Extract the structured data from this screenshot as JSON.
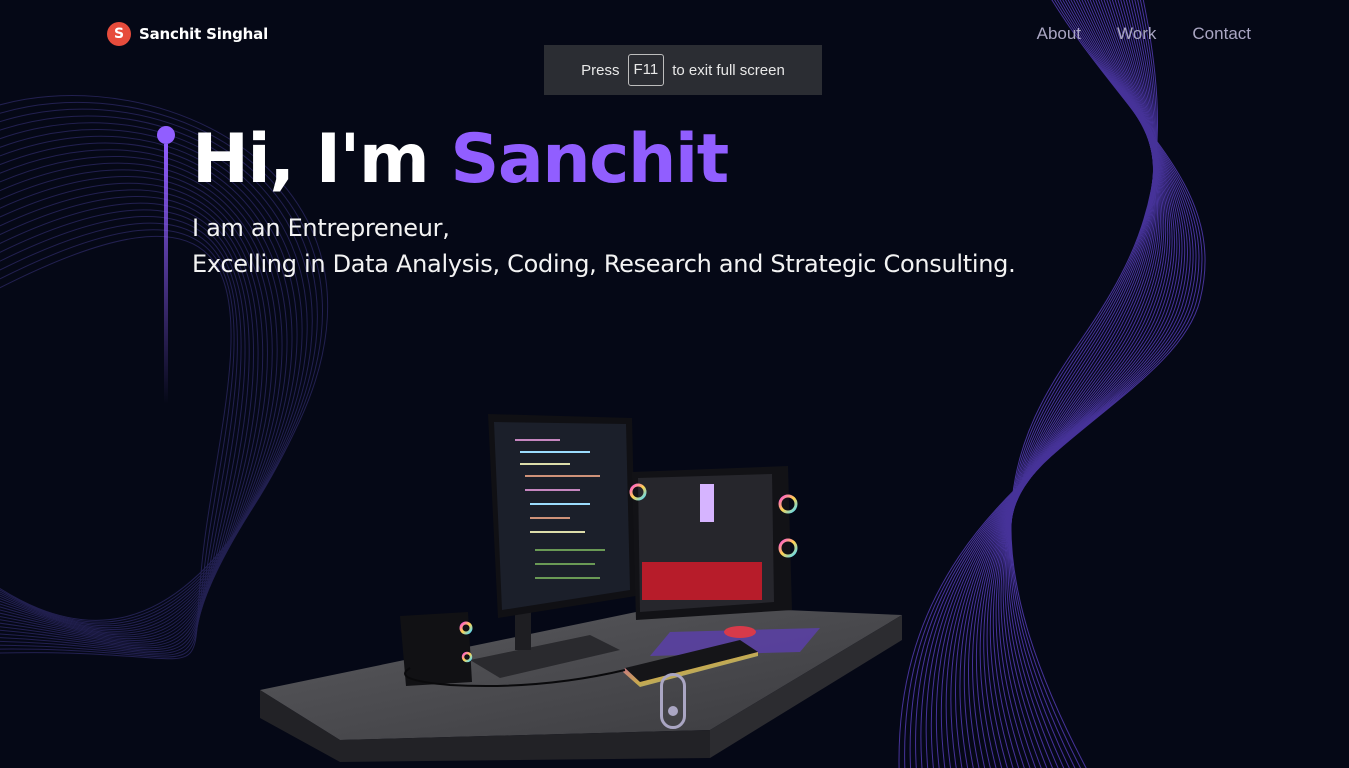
{
  "nav": {
    "logo_letter": "S",
    "brand_name": "Sanchit Singhal",
    "links": [
      {
        "label": "About"
      },
      {
        "label": "Work"
      },
      {
        "label": "Contact"
      }
    ]
  },
  "fullscreen_toast": {
    "before": "Press",
    "key": "F11",
    "after": "to exit full screen"
  },
  "hero": {
    "greeting": "Hi, I'm",
    "name": "Sanchit",
    "line1": "I am an Entrepreneur,",
    "line2": "Excelling in Data Analysis, Coding, Research and Strategic Consulting."
  },
  "colors": {
    "background": "#050816",
    "accent": "#915eff",
    "nav_text": "#aaa6c3",
    "logo": "#e74c3c"
  },
  "icons": {
    "logo": "s-circle-logo-icon",
    "scroll": "mouse-scroll-icon"
  }
}
